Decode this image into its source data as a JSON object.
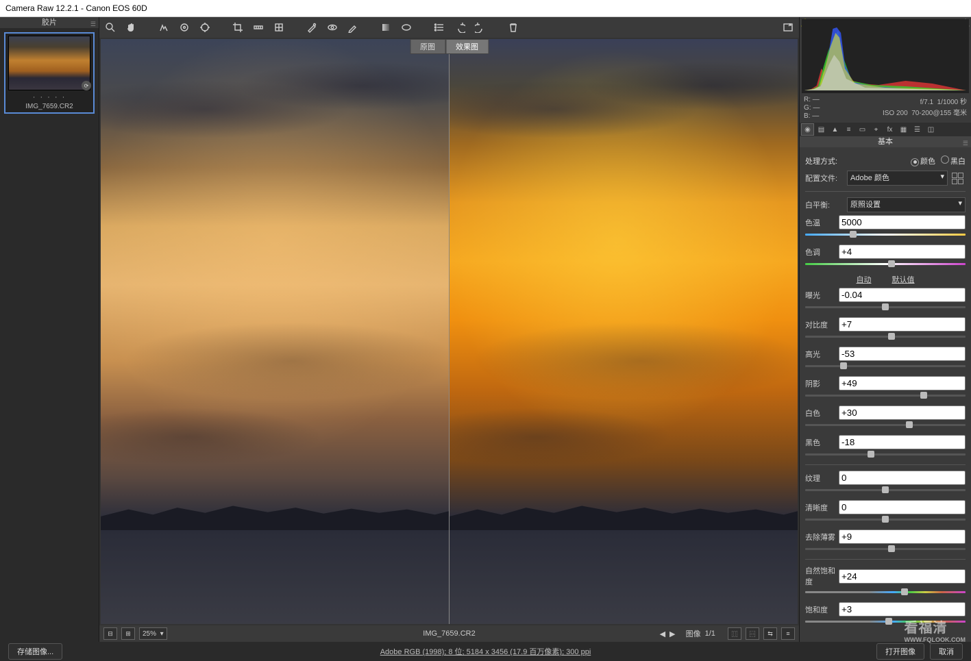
{
  "titlebar": "Camera Raw 12.2.1 -  Canon EOS 60D",
  "filmstrip": {
    "header": "胶片",
    "thumb": {
      "name": "IMG_7659.CR2",
      "dots": "· · · · ·"
    }
  },
  "toolbar_icons": [
    "zoom",
    "hand",
    "wb-pick",
    "color-sampler",
    "target",
    "crop",
    "straighten",
    "transform",
    "spot",
    "redeye",
    "brush",
    "grad",
    "radial",
    "elliptical",
    "list",
    "undo",
    "redo",
    "trash",
    "fullscreen"
  ],
  "split": {
    "before": "原图",
    "after": "效果图"
  },
  "histogram": {
    "rgb": {
      "r": "—",
      "g": "—",
      "b": "—"
    },
    "exif": {
      "aperture": "f/7.1",
      "shutter": "1/1000 秒",
      "iso": "ISO 200",
      "lens": "70-200@155 毫米"
    }
  },
  "panel_tabs": [
    "basic",
    "curve",
    "detail",
    "mix",
    "split",
    "lens",
    "fx",
    "calib",
    "presets",
    "snap"
  ],
  "panel": {
    "title": "基本",
    "treatment_label": "处理方式:",
    "treatment_opts": {
      "color": "颜色",
      "bw": "黑白"
    },
    "profile_label": "配置文件:",
    "profile_value": "Adobe 颜色",
    "wb_label": "白平衡:",
    "wb_value": "原照设置",
    "auto_label": "自动",
    "default_label": "默认值",
    "sliders": {
      "temp": {
        "label": "色温",
        "value": "5000",
        "pos": 30,
        "bar": "temp"
      },
      "tint": {
        "label": "色调",
        "value": "+4",
        "pos": 54,
        "bar": "tint"
      },
      "exposure": {
        "label": "曝光",
        "value": "-0.04",
        "pos": 50,
        "bar": ""
      },
      "contrast": {
        "label": "对比度",
        "value": "+7",
        "pos": 54,
        "bar": ""
      },
      "highlights": {
        "label": "高光",
        "value": "-53",
        "pos": 24,
        "bar": ""
      },
      "shadows": {
        "label": "阴影",
        "value": "+49",
        "pos": 74,
        "bar": ""
      },
      "whites": {
        "label": "白色",
        "value": "+30",
        "pos": 65,
        "bar": ""
      },
      "blacks": {
        "label": "黑色",
        "value": "-18",
        "pos": 41,
        "bar": ""
      },
      "texture": {
        "label": "纹理",
        "value": "0",
        "pos": 50,
        "bar": ""
      },
      "clarity": {
        "label": "清晰度",
        "value": "0",
        "pos": 50,
        "bar": ""
      },
      "dehaze": {
        "label": "去除薄雾",
        "value": "+9",
        "pos": 54,
        "bar": ""
      },
      "vibrance": {
        "label": "自然饱和度",
        "value": "+24",
        "pos": 62,
        "bar": "vib"
      },
      "saturation": {
        "label": "饱和度",
        "value": "+3",
        "pos": 52,
        "bar": "sat"
      }
    }
  },
  "imgbar": {
    "zoom": "25%",
    "name": "IMG_7659.CR2",
    "counter_label": "图像",
    "counter": "1/1"
  },
  "bottom": {
    "save": "存储图像...",
    "meta": "Adobe RGB (1998); 8 位;  5184 x 3456 (17.9 百万像素); 300 ppi",
    "open": "打开图像",
    "cancel": "取消"
  },
  "watermark": {
    "main": "看福清",
    "sub": "WWW.FQLOOK.COM"
  }
}
